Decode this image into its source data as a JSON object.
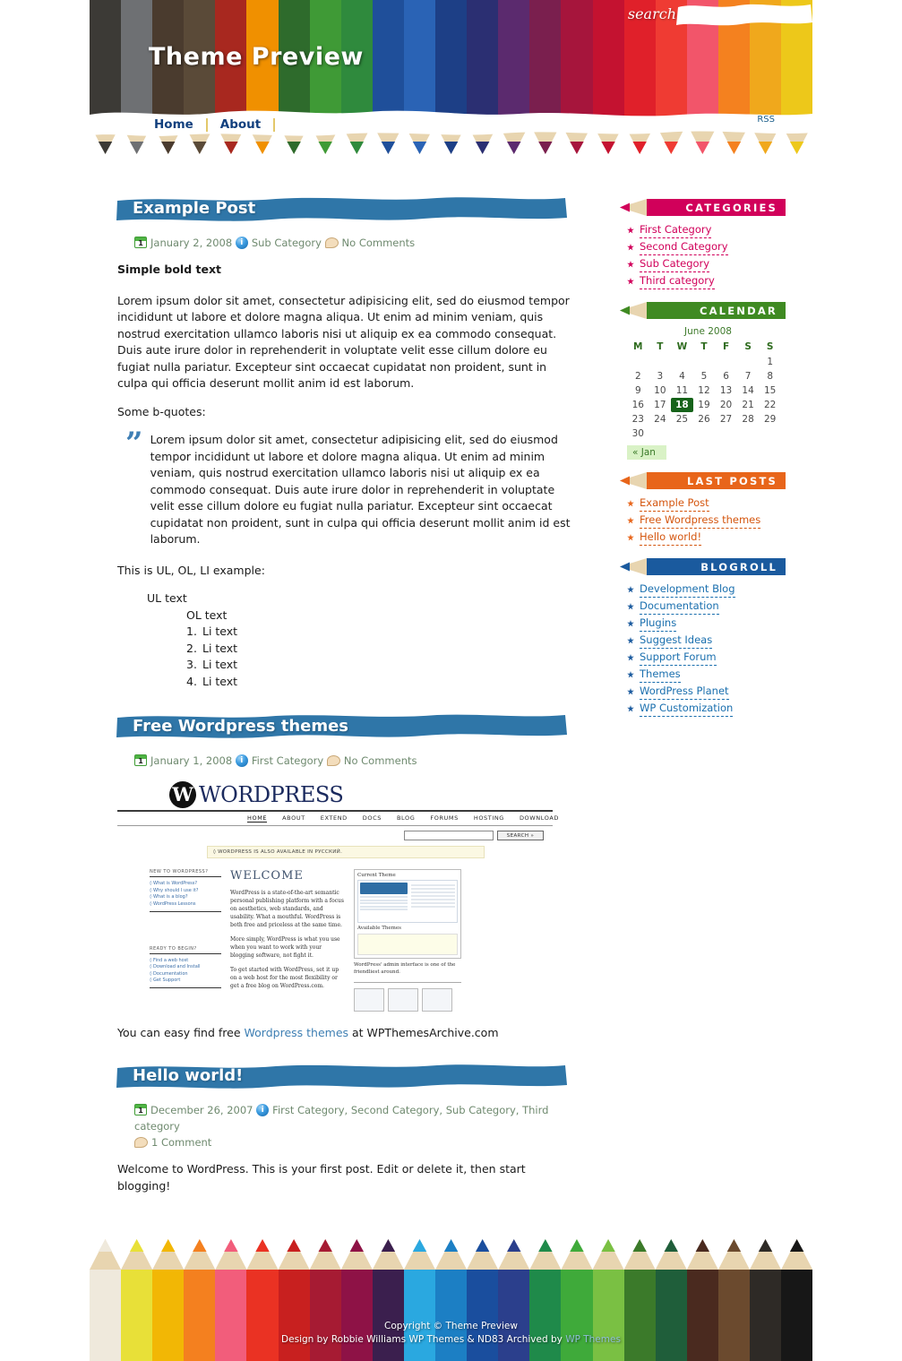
{
  "site": {
    "title": "Theme Preview",
    "search_label": "search",
    "search_placeholder": "",
    "search_value": "",
    "rss_label": "RSS"
  },
  "nav": {
    "items": [
      {
        "label": "Home"
      },
      {
        "label": "About"
      }
    ]
  },
  "posts": [
    {
      "title": "Example Post",
      "date": "January 2, 2008",
      "categories": "Sub Category",
      "comments": "No Comments",
      "bold_lead": "Simple bold text",
      "para1": "Lorem ipsum dolor sit amet, consectetur adipisicing elit, sed do eiusmod tempor incididunt ut labore et dolore magna aliqua. Ut enim ad minim veniam, quis nostrud exercitation ullamco laboris nisi ut aliquip ex ea commodo consequat. Duis aute irure dolor in reprehenderit in voluptate velit esse cillum dolore eu fugiat nulla pariatur. Excepteur sint occaecat cupidatat non proident, sunt in culpa qui officia deserunt mollit anim id est laborum.",
      "para2": "Some b-quotes:",
      "blockquote": "Lorem ipsum dolor sit amet, consectetur adipisicing elit, sed do eiusmod tempor incididunt ut labore et dolore magna aliqua. Ut enim ad minim veniam, quis nostrud exercitation ullamco laboris nisi ut aliquip ex ea commodo consequat. Duis aute irure dolor in reprehenderit in voluptate velit esse cillum dolore eu fugiat nulla pariatur. Excepteur sint occaecat cupidatat non proident, sunt in culpa qui officia deserunt mollit anim id est laborum.",
      "list_intro": "This is UL, OL, LI example:",
      "ul_text": "UL text",
      "ol_text": "OL text",
      "li_items": [
        "Li text",
        "Li text",
        "Li text",
        "Li text"
      ]
    },
    {
      "title": "Free Wordpress themes",
      "date": "January 1, 2008",
      "categories": "First Category",
      "comments": "No Comments",
      "outro_before": "You can easy find free ",
      "outro_link": "Wordpress themes",
      "outro_after": " at WPThemesArchive.com"
    },
    {
      "title": "Hello world!",
      "date": "December 26, 2007",
      "categories": "First Category, Second Category, Sub Category, Third category",
      "comments": "1 Comment",
      "body": "Welcome to WordPress. This is your first post. Edit or delete it, then start blogging!"
    }
  ],
  "wp_shot": {
    "logo_word": "WORDPRESS",
    "logo_mark": "W",
    "nav": [
      "HOME",
      "ABOUT",
      "EXTEND",
      "DOCS",
      "BLOG",
      "FORUMS",
      "HOSTING",
      "DOWNLOAD"
    ],
    "search_button": "SEARCH »",
    "banner": "◊ WORDPRESS IS ALSO AVAILABLE IN РУССКИЙ.",
    "welcome_heading": "WELCOME",
    "left_head_1": "NEW TO WORDPRESS?",
    "left_items_1": [
      "◊ What is WordPress?",
      "◊ Why should I use it?",
      "◊ What is a blog?",
      "◊ WordPress Lessons"
    ],
    "left_head_2": "READY TO BEGIN?",
    "left_items_2": [
      "◊ Find a web host",
      "◊ Download and Install",
      "◊ Documentation",
      "◊ Get Support"
    ],
    "para1": "WordPress is a state-of-the-art semantic personal publishing platform with a focus on aesthetics, web standards, and usability. What a mouthful. WordPress is both free and priceless at the same time.",
    "para2": "More simply, WordPress is what you use when you want to work with your blogging software, not fight it.",
    "para3": "To get started with WordPress, set it up on a web host for the most flexibility or get a free blog on WordPress.com.",
    "panel_label_1": "Current Theme",
    "panel_label_2": "Available Themes",
    "panel_caption": "WordPress' admin interface is one of the friendliest around."
  },
  "sidebar": {
    "widgets": [
      {
        "name": "categories",
        "heading": "CATEGORIES",
        "color": "#d1005a",
        "text_color": "#d1005a",
        "items": [
          {
            "label": "First Category"
          },
          {
            "label": "Second Category"
          },
          {
            "label": "Sub Category"
          },
          {
            "label": "Third category"
          }
        ]
      },
      {
        "name": "last-posts",
        "heading": "LAST POSTS",
        "color": "#e8651a",
        "text_color": "#d4560f",
        "items": [
          {
            "label": "Example Post"
          },
          {
            "label": "Free Wordpress themes"
          },
          {
            "label": "Hello world!"
          }
        ]
      },
      {
        "name": "blogroll",
        "heading": "BLOGROLL",
        "color": "#1a5a9e",
        "text_color": "#1a6fae",
        "items": [
          {
            "label": "Development Blog"
          },
          {
            "label": "Documentation"
          },
          {
            "label": "Plugins"
          },
          {
            "label": "Suggest Ideas"
          },
          {
            "label": "Support Forum"
          },
          {
            "label": "Themes"
          },
          {
            "label": "WordPress Planet"
          },
          {
            "label": "WP Customization"
          }
        ]
      }
    ],
    "calendar": {
      "heading": "CALENDAR",
      "color": "#3f8a22",
      "caption": "June 2008",
      "weekdays": [
        "M",
        "T",
        "W",
        "T",
        "F",
        "S",
        "S"
      ],
      "weeks": [
        [
          "",
          "",
          "",
          "",
          "",
          "",
          "1"
        ],
        [
          "2",
          "3",
          "4",
          "5",
          "6",
          "7",
          "8"
        ],
        [
          "9",
          "10",
          "11",
          "12",
          "13",
          "14",
          "15"
        ],
        [
          "16",
          "17",
          "18",
          "19",
          "20",
          "21",
          "22"
        ],
        [
          "23",
          "24",
          "25",
          "26",
          "27",
          "28",
          "29"
        ],
        [
          "30",
          "",
          "",
          "",
          "",
          "",
          ""
        ]
      ],
      "today": "18",
      "prev_label": "« Jan"
    }
  },
  "footer": {
    "line1": "Copyright © Theme Preview",
    "line2_before": "Design by Robbie Williams WP Themes & ND83 Archived by ",
    "line2_link": "WP Themes"
  },
  "palette": {
    "header_pencils": [
      "#3c3a36",
      "#6e7073",
      "#4a3b2e",
      "#5a4a38",
      "#a8281f",
      "#f09000",
      "#2e6b2c",
      "#3f9a36",
      "#2f8a3d",
      "#1f4f9a",
      "#2a63b5",
      "#1d3f86",
      "#2b2f72",
      "#5b2a6e",
      "#7a1f4e",
      "#a6153c",
      "#c41230",
      "#e0202a",
      "#ef3b33",
      "#f2556a",
      "#f4811f",
      "#f0a81c",
      "#edc81a"
    ],
    "footer_pencils": [
      "#efe9dc",
      "#e8e038",
      "#f2b705",
      "#f4801f",
      "#f25d7b",
      "#ea3223",
      "#c8201f",
      "#a61b33",
      "#8e1246",
      "#3b1f4e",
      "#2aa8e0",
      "#1c7fc4",
      "#1a4e9e",
      "#2b3f8c",
      "#1f8a4a",
      "#3faa3a",
      "#7ac043",
      "#3b7a2a",
      "#1f5e3a",
      "#4a2a1f",
      "#6b4a2e",
      "#2e2a26",
      "#171717"
    ],
    "post_brush": "#2f76a8",
    "nav_link": "#12407e",
    "meta_text": "#6f8a6f"
  }
}
